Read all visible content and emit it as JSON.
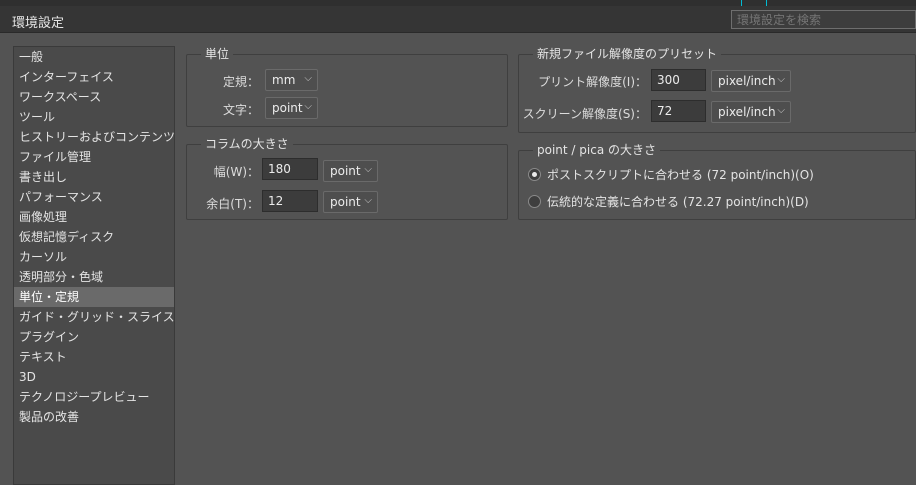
{
  "window": {
    "title": "環境設定"
  },
  "search": {
    "placeholder": "環境設定を検索"
  },
  "sidebar": {
    "items": [
      {
        "label": "一般"
      },
      {
        "label": "インターフェイス"
      },
      {
        "label": "ワークスペース"
      },
      {
        "label": "ツール"
      },
      {
        "label": "ヒストリーおよびコンテンツ認証..."
      },
      {
        "label": "ファイル管理"
      },
      {
        "label": "書き出し"
      },
      {
        "label": "パフォーマンス"
      },
      {
        "label": "画像処理"
      },
      {
        "label": "仮想記憶ディスク"
      },
      {
        "label": "カーソル"
      },
      {
        "label": "透明部分・色域"
      },
      {
        "label": "単位・定規"
      },
      {
        "label": "ガイド・グリッド・スライス"
      },
      {
        "label": "プラグイン"
      },
      {
        "label": "テキスト"
      },
      {
        "label": "3D"
      },
      {
        "label": "テクノロジープレビュー"
      },
      {
        "label": "製品の改善"
      }
    ],
    "selected_index": 12
  },
  "units": {
    "title": "単位",
    "ruler_label": "定規：",
    "ruler_value": "mm",
    "type_label": "文字：",
    "type_value": "point"
  },
  "column": {
    "title": "コラムの大きさ",
    "width_label": "幅(W)：",
    "width_value": "180",
    "width_unit": "point",
    "gutter_label": "余白(T)：",
    "gutter_value": "12",
    "gutter_unit": "point"
  },
  "resolution": {
    "title": "新規ファイル解像度のプリセット",
    "print_label": "プリント解像度(I)：",
    "print_value": "300",
    "print_unit": "pixel/inch",
    "screen_label": "スクリーン解像度(S)：",
    "screen_value": "72",
    "screen_unit": "pixel/inch"
  },
  "pica": {
    "title": "point / pica の大きさ",
    "option1": "ポストスクリプトに合わせる (72 point/inch)(O)",
    "option2": "伝統的な定義に合わせる (72.27 point/inch)(D)"
  }
}
